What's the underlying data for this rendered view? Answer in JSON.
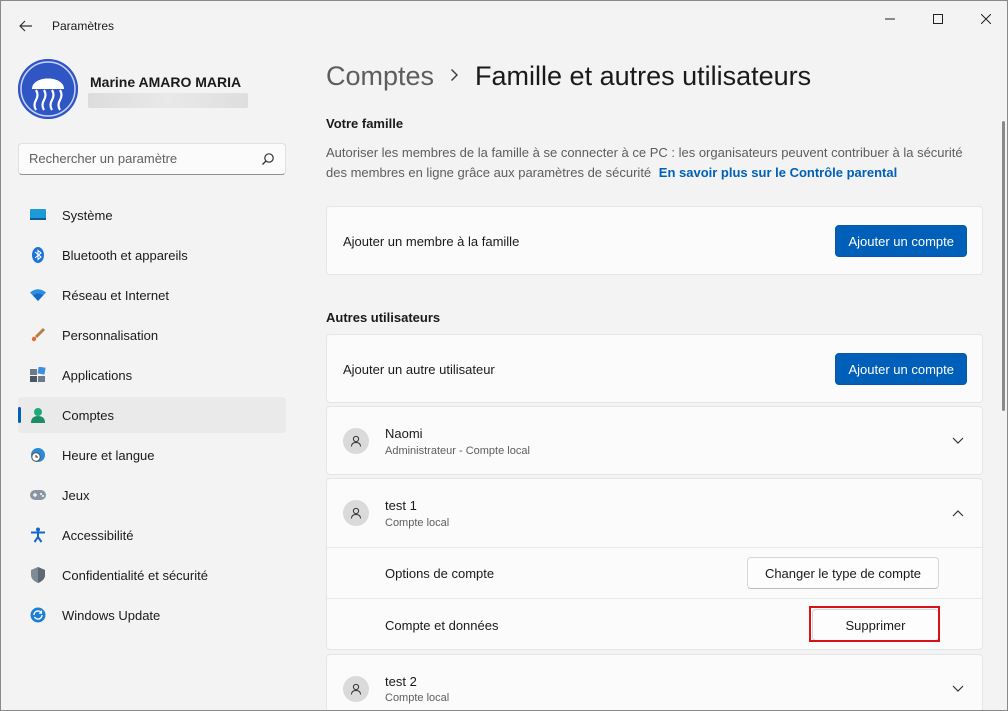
{
  "window": {
    "title": "Paramètres"
  },
  "profile": {
    "name": "Marine AMARO MARIA"
  },
  "search": {
    "placeholder": "Rechercher un paramètre"
  },
  "sidebar": {
    "items": [
      {
        "label": "Système",
        "icon": "display-icon"
      },
      {
        "label": "Bluetooth et appareils",
        "icon": "bluetooth-icon"
      },
      {
        "label": "Réseau et Internet",
        "icon": "wifi-icon"
      },
      {
        "label": "Personnalisation",
        "icon": "brush-icon"
      },
      {
        "label": "Applications",
        "icon": "apps-icon"
      },
      {
        "label": "Comptes",
        "icon": "person-icon",
        "active": true
      },
      {
        "label": "Heure et langue",
        "icon": "clock-globe-icon"
      },
      {
        "label": "Jeux",
        "icon": "gamepad-icon"
      },
      {
        "label": "Accessibilité",
        "icon": "accessibility-icon"
      },
      {
        "label": "Confidentialité et sécurité",
        "icon": "shield-icon"
      },
      {
        "label": "Windows Update",
        "icon": "update-icon"
      }
    ]
  },
  "breadcrumb": {
    "parent": "Comptes",
    "current": "Famille et autres utilisateurs"
  },
  "family": {
    "title": "Votre famille",
    "description": "Autoriser les membres de la famille à se connecter à ce PC : les organisateurs peuvent contribuer à la sécurité des membres en ligne grâce aux paramètres de sécurité",
    "link": "En savoir plus sur le Contrôle parental",
    "add_label": "Ajouter un membre à la famille",
    "add_button": "Ajouter un compte"
  },
  "others": {
    "title": "Autres utilisateurs",
    "add_label": "Ajouter un autre utilisateur",
    "add_button": "Ajouter un compte",
    "users": [
      {
        "name": "Naomi",
        "subtitle": "Administrateur - Compte local",
        "expanded": false
      },
      {
        "name": "test 1",
        "subtitle": "Compte local",
        "expanded": true,
        "options_label": "Options de compte",
        "options_button": "Changer le type de compte",
        "data_label": "Compte et données",
        "data_button": "Supprimer"
      },
      {
        "name": "test 2",
        "subtitle": "Compte local",
        "expanded": false
      }
    ]
  },
  "colors": {
    "accent": "#005fb8",
    "highlight": "#d6131a"
  }
}
